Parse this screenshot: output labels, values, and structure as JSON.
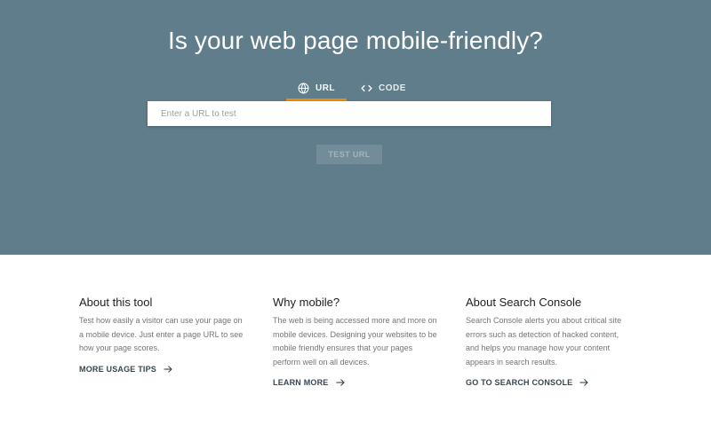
{
  "hero": {
    "title": "Is your web page mobile-friendly?",
    "tabs": [
      {
        "label": "URL",
        "icon": "globe-icon",
        "active": true
      },
      {
        "label": "CODE",
        "icon": "code-brackets-icon",
        "active": false
      }
    ],
    "url_input": {
      "placeholder": "Enter a URL to test",
      "value": ""
    },
    "test_button": "TEST URL",
    "colors": {
      "background": "#607d8b",
      "tab_indicator": "#ef8c00"
    }
  },
  "cards": [
    {
      "title": "About this tool",
      "body": "Test how easily a visitor can use your page on a mobile device. Just enter a page URL to see how your page scores.",
      "link": "MORE USAGE TIPS",
      "link_icon": "arrow-right-icon"
    },
    {
      "title": "Why mobile?",
      "body": "The web is being accessed more and more on mobile devices. Designing your websites to be mobile friendly ensures that your pages perform well on all devices.",
      "link": "LEARN MORE",
      "link_icon": "arrow-right-icon"
    },
    {
      "title": "About Search Console",
      "body": "Search Console alerts you about critical site errors such as detection of hacked content, and helps you manage how your content appears in search results.",
      "link": "GO TO SEARCH CONSOLE",
      "link_icon": "arrow-right-icon"
    }
  ]
}
